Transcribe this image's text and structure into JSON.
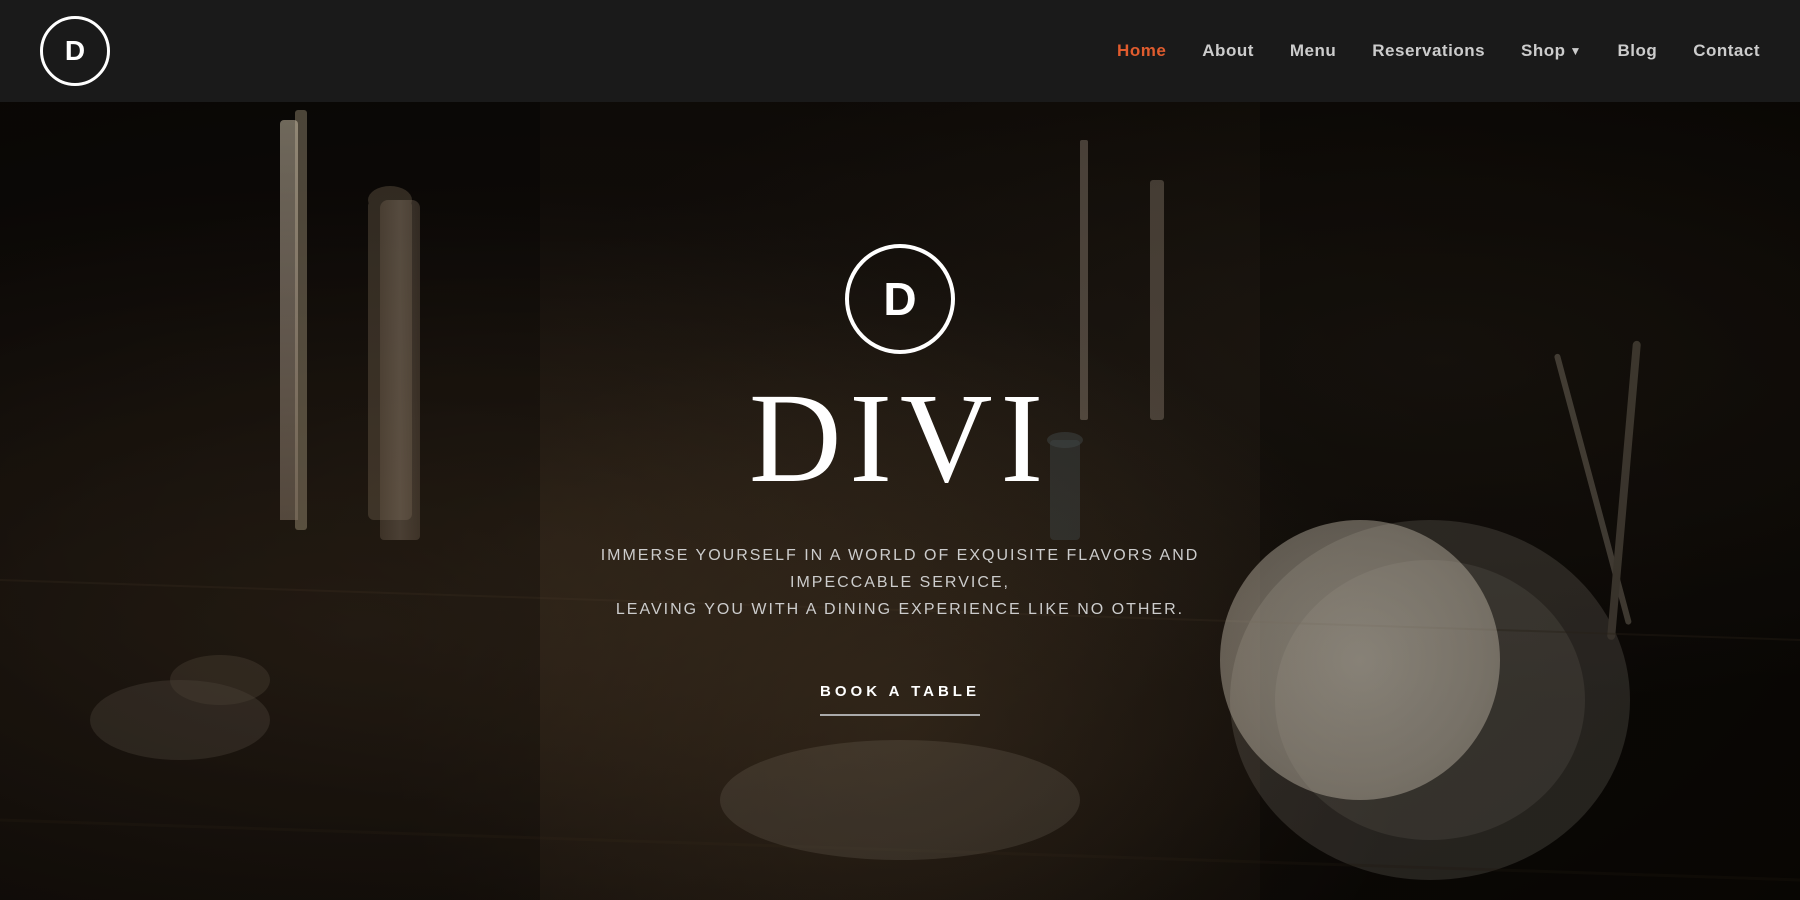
{
  "navbar": {
    "logo_letter": "D",
    "links": [
      {
        "id": "home",
        "label": "Home",
        "active": true
      },
      {
        "id": "about",
        "label": "About",
        "active": false
      },
      {
        "id": "menu",
        "label": "Menu",
        "active": false
      },
      {
        "id": "reservations",
        "label": "Reservations",
        "active": false
      },
      {
        "id": "shop",
        "label": "Shop",
        "active": false,
        "has_dropdown": true
      },
      {
        "id": "blog",
        "label": "Blog",
        "active": false
      },
      {
        "id": "contact",
        "label": "Contact",
        "active": false
      }
    ]
  },
  "hero": {
    "logo_letter": "D",
    "brand_name": "DIVI",
    "tagline_line1": "IMMERSE YOURSELF IN A WORLD OF EXQUISITE FLAVORS AND IMPECCABLE SERVICE,",
    "tagline_line2": "LEAVING YOU WITH A DINING EXPERIENCE LIKE NO OTHER.",
    "cta_label": "BOOK A TABLE"
  },
  "colors": {
    "active_nav": "#e05c2e",
    "nav_bg": "#1a1a1a",
    "hero_title": "#ffffff",
    "hero_tagline": "#cccccc",
    "cta_text": "#ffffff",
    "cta_line": "#aaaaaa",
    "logo_border": "#ffffff"
  }
}
